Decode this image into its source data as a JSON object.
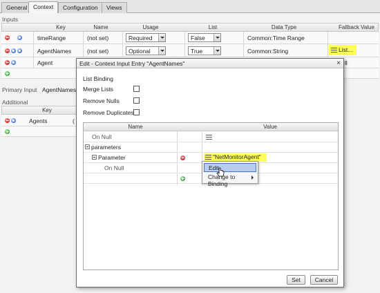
{
  "tabs": [
    {
      "label": "General"
    },
    {
      "label": "Context"
    },
    {
      "label": "Configuration"
    },
    {
      "label": "Views"
    }
  ],
  "inputs": {
    "section_label": "Inputs",
    "columns": [
      "Key",
      "Name",
      "Usage",
      "List",
      "Data Type",
      "Fallback Value"
    ],
    "rows": [
      {
        "key": "timeRange",
        "name": "(not set)",
        "usage": "Required",
        "list": "False",
        "data_type": "Common:Time Range",
        "fallback": ""
      },
      {
        "key": "AgentNames",
        "name": "(not set)",
        "usage": "Optional",
        "list": "True",
        "data_type": "Common:String",
        "fallback": "List..."
      },
      {
        "key": "Agent",
        "name": "",
        "usage": "",
        "list": "",
        "data_type": "",
        "fallback": "ll"
      }
    ]
  },
  "primary_input": {
    "label": "Primary Input",
    "value": "AgentNames"
  },
  "additional": {
    "section_label": "Additional",
    "columns": [
      "Key"
    ],
    "rows": [
      {
        "key": "Agents",
        "rest": "("
      }
    ]
  },
  "dialog": {
    "title": "Edit - Context Input Entry \"AgentNames\"",
    "close": "×",
    "section_label": "List Binding",
    "options": [
      {
        "label": "Merge Lists",
        "checked": false
      },
      {
        "label": "Remove Nulls",
        "checked": false
      },
      {
        "label": "Remove Duplicates",
        "checked": false
      }
    ],
    "grid": {
      "columns": [
        "Name",
        "Value"
      ],
      "rows": [
        {
          "name": "On Null",
          "value": ""
        },
        {
          "name": "parameters",
          "value": ""
        },
        {
          "name": "Parameter",
          "value": "\"NetMonitorAgent\""
        },
        {
          "name": "On Null",
          "value": ""
        }
      ]
    },
    "buttons": {
      "set": "Set",
      "cancel": "Cancel"
    }
  },
  "context_menu": {
    "items": [
      {
        "label": "Edit"
      },
      {
        "label": "Change to Binding"
      }
    ]
  },
  "colors": {
    "highlight": "#ffff5a",
    "menu_selection": "#b9cdf0",
    "remove_dot": "#cc1f1f",
    "add_dot": "#2a9a2a"
  }
}
